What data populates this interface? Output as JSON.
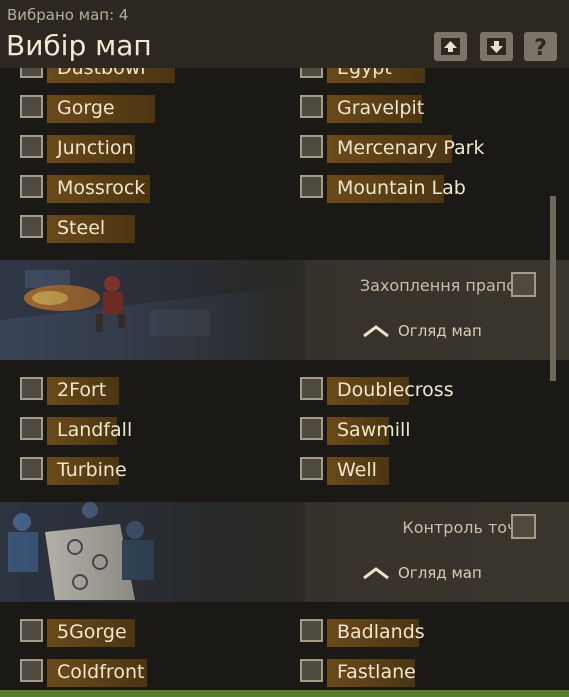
{
  "header": {
    "selected_count": "Вибрано мап: 4",
    "title": "Вибір мап"
  },
  "groups": [
    {
      "name": "",
      "maps": [
        "Dustbowl",
        "Egypt",
        "Gorge",
        "Gravelpit",
        "Junction",
        "Mercenary Park",
        "Mossrock",
        "Mountain Lab",
        "Steel"
      ]
    },
    {
      "name": "Захоплення прапора",
      "overview": "Огляд мап",
      "maps": [
        "2Fort",
        "Doublecross",
        "Landfall",
        "Sawmill",
        "Turbine",
        "Well"
      ]
    },
    {
      "name": "Контроль точок",
      "overview": "Огляд мап",
      "maps": [
        "5Gorge",
        "Badlands",
        "Coldfront",
        "Fastlane"
      ]
    }
  ],
  "colors": {
    "background": "#1b1915",
    "header": "#2c2821",
    "label_highlight": "#6b4a1a",
    "checkbox": "#4e4a3f",
    "accent_bar": "#5a7c2a"
  }
}
